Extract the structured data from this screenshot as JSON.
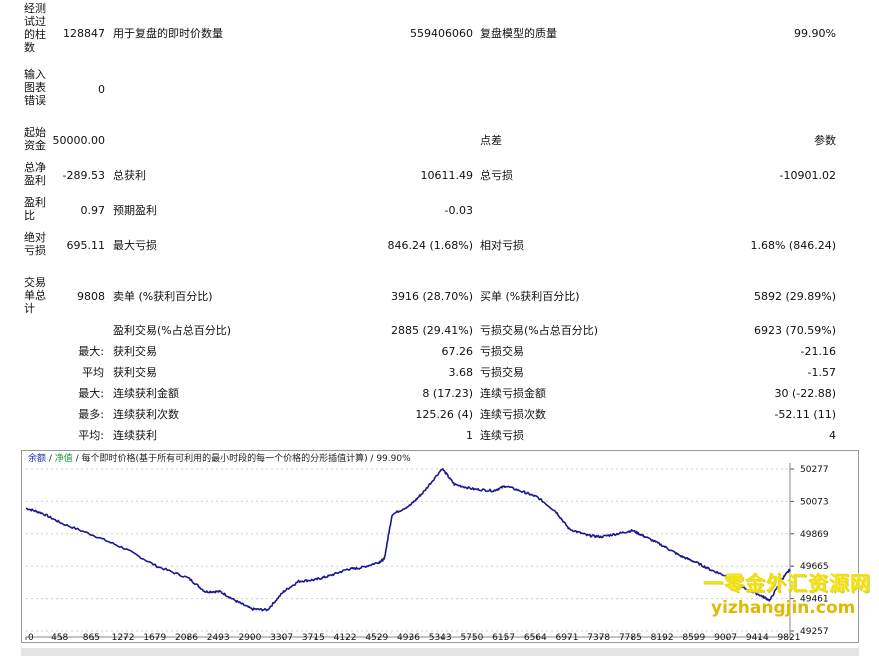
{
  "report": {
    "r1": {
      "label": "经测试过的柱数",
      "value": "128847",
      "label2": "用于复盘的即时价数量",
      "value2": "559406060",
      "label3": "复盘模型的质量",
      "value3": "99.90%"
    },
    "r2": {
      "label": "输入图表错误",
      "value": "0"
    },
    "r3": {
      "label": "起始资金",
      "value": "50000.00",
      "label3": "点差",
      "value3": "参数"
    },
    "r4": {
      "label": "总净盈利",
      "value": "-289.53",
      "label2": "总获利",
      "value2": "10611.49",
      "label3": "总亏损",
      "value3": "-10901.02"
    },
    "r5": {
      "label": "盈利比",
      "value": "0.97",
      "label2": "预期盈利",
      "value2": "-0.03"
    },
    "r6": {
      "label": "绝对亏损",
      "value": "695.11",
      "label2": "最大亏损",
      "value2": "846.24 (1.68%)",
      "label3": "相对亏损",
      "value3": "1.68% (846.24)"
    },
    "r7": {
      "label": "交易单总计",
      "value": "9808",
      "label2": "卖单 (%获利百分比)",
      "value2": "3916 (28.70%)",
      "label3": "买单 (%获利百分比)",
      "value3": "5892 (29.89%)"
    },
    "r8": {
      "label2": "盈利交易(%占总百分比)",
      "value2": "2885 (29.41%)",
      "label3": "亏损交易(%占总百分比)",
      "value3": "6923 (70.59%)"
    },
    "r9": {
      "label0": "最大:",
      "label2": "获利交易",
      "value2": "67.26",
      "label3": "亏损交易",
      "value3": "-21.16"
    },
    "r10": {
      "label0": "平均",
      "label2": "获利交易",
      "value2": "3.68",
      "label3": "亏损交易",
      "value3": "-1.57"
    },
    "r11": {
      "label0": "最大:",
      "label2": "连续获利金额",
      "value2": "8 (17.23)",
      "label3": "连续亏损金额",
      "value3": "30 (-22.88)"
    },
    "r12": {
      "label0": "最多:",
      "label2": "连续获利次数",
      "value2": "125.26 (4)",
      "label3": "连续亏损次数",
      "value3": "-52.11 (11)"
    },
    "r13": {
      "label0": "平均:",
      "label2": "连续获利",
      "value2": "1",
      "label3": "连续亏损",
      "value3": "4"
    }
  },
  "chart": {
    "legend_balance": "余额",
    "legend_sep1": " / ",
    "legend_equity": "净值",
    "legend_rest": " / 每个即时价格(基于所有可利用的最小时段的每一个价格的分形插值计算) / 99.90%",
    "watermark_cn": "一零金外汇资源网",
    "watermark_url": "yizhangjin.com",
    "line_color": "#1a1a8c"
  },
  "chart_data": {
    "type": "line",
    "x_ticks": [
      "0",
      "458",
      "865",
      "1272",
      "1679",
      "2086",
      "2493",
      "2900",
      "3307",
      "3715",
      "4122",
      "4529",
      "4936",
      "5343",
      "5750",
      "6157",
      "6564",
      "6971",
      "7378",
      "7785",
      "8192",
      "8599",
      "9007",
      "9414",
      "9821"
    ],
    "y_ticks": [
      "50277",
      "50073",
      "49869",
      "49665",
      "49461",
      "49257"
    ],
    "ylim": [
      49257,
      50277
    ],
    "xlim": [
      0,
      9808
    ],
    "grid": true,
    "series": [
      {
        "x": [
          0,
          200,
          458,
          865,
          1272,
          1679,
          2086,
          2300,
          2493,
          2700,
          2900,
          3100,
          3307,
          3500,
          3715,
          3900,
          4122,
          4300,
          4529,
          4600,
          4700,
          4936,
          5100,
          5343,
          5500,
          5750,
          6000,
          6157,
          6400,
          6564,
          6800,
          6971,
          7200,
          7378,
          7600,
          7785,
          7950,
          8192,
          8400,
          8599,
          8800,
          9007,
          9200,
          9414,
          9550,
          9700,
          9808
        ],
        "y": [
          50030,
          50000,
          49935,
          49860,
          49775,
          49665,
          49590,
          49505,
          49505,
          49445,
          49395,
          49390,
          49505,
          49570,
          49580,
          49605,
          49645,
          49655,
          49690,
          49710,
          49990,
          50050,
          50130,
          50280,
          50180,
          50150,
          50140,
          50170,
          50130,
          50100,
          50010,
          49900,
          49860,
          49850,
          49870,
          49890,
          49850,
          49790,
          49730,
          49690,
          49640,
          49600,
          49530,
          49485,
          49450,
          49580,
          49645
        ]
      }
    ]
  }
}
